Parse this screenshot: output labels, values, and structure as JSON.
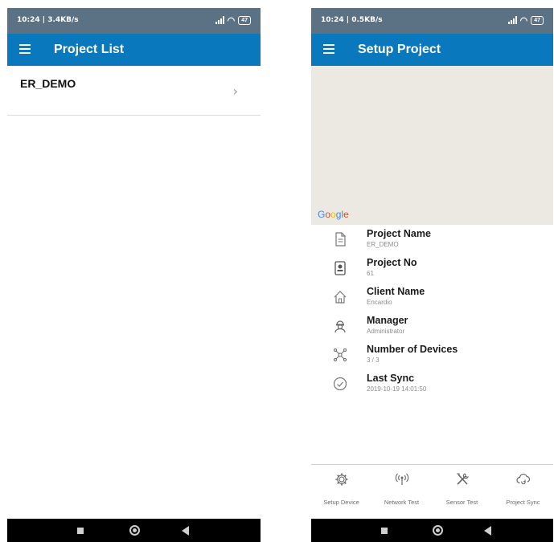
{
  "left": {
    "status": {
      "time_speed": "10:24 | 3.4KB/s",
      "battery": "47"
    },
    "appbar": {
      "title": "Project List"
    },
    "projects": [
      {
        "name": "ER_DEMO"
      }
    ]
  },
  "right": {
    "status": {
      "time_speed": "10:24 | 0.5KB/s",
      "battery": "47"
    },
    "appbar": {
      "title": "Setup Project"
    },
    "map": {
      "attribution": "Google"
    },
    "details": [
      {
        "label": "Project Name",
        "value": "ER_DEMO",
        "icon": "document-icon"
      },
      {
        "label": "Project No",
        "value": "61",
        "icon": "id-badge-icon"
      },
      {
        "label": "Client Name",
        "value": "Encardio",
        "icon": "home-icon"
      },
      {
        "label": "Manager",
        "value": "Administrator",
        "icon": "manager-icon"
      },
      {
        "label": "Number of Devices",
        "value": "3 / 3",
        "icon": "network-nodes-icon"
      },
      {
        "label": "Last Sync",
        "value": "2019-10-19 14:01:50",
        "icon": "check-circle-icon"
      }
    ],
    "tabs": [
      {
        "label": "Setup Device",
        "icon": "gear-icon"
      },
      {
        "label": "Network Test",
        "icon": "antenna-icon"
      },
      {
        "label": "Sensor Test",
        "icon": "tools-icon"
      },
      {
        "label": "Project Sync",
        "icon": "cloud-sync-icon"
      }
    ]
  },
  "colors": {
    "appbar": "#0a78bd",
    "statusbar": "#5b7285",
    "map_background": "#ebe9e2",
    "google_blue": "#4285f4",
    "google_red": "#ea4335",
    "google_yellow": "#fbbc05",
    "google_green": "#34a853"
  }
}
